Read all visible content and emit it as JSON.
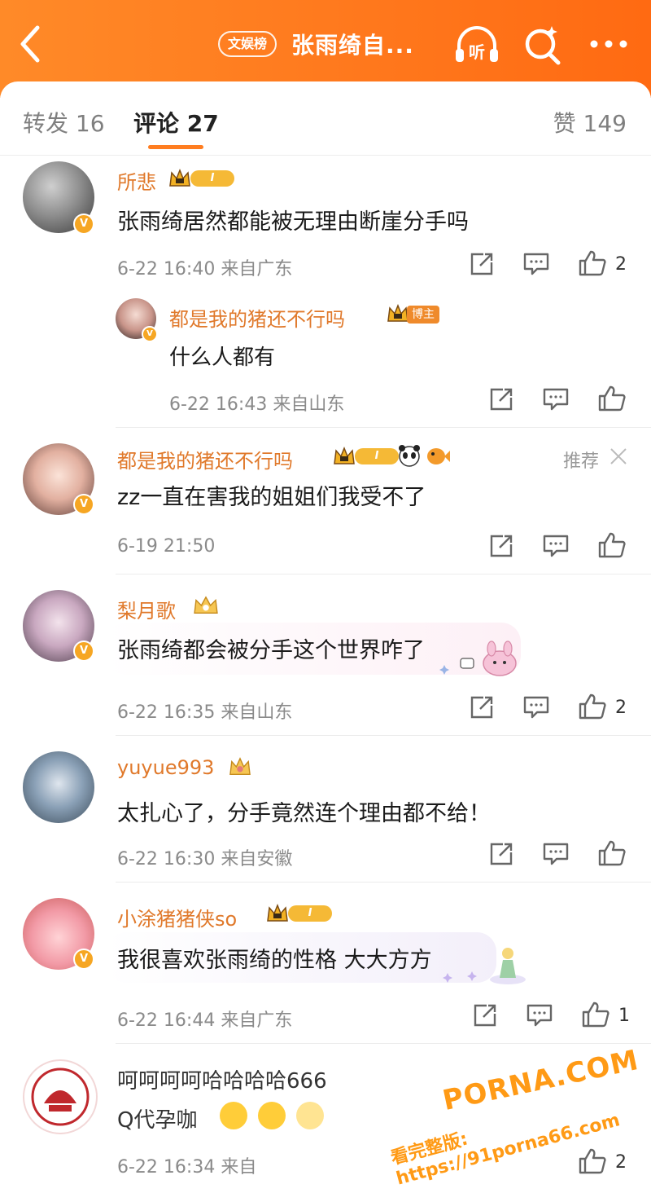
{
  "header": {
    "back_icon": "chevron-left-icon",
    "tag": "文娱榜",
    "title": "张雨绮自...",
    "listen_label": "听",
    "search_icon": "search-sparkle-icon",
    "more_icon": "more-dots-icon"
  },
  "tabs": {
    "repost": "转发 16",
    "comment": "评论 27",
    "like": "赞 149"
  },
  "comments": [
    {
      "username": "所悲",
      "level": "I",
      "text": "张雨绮居然都能被无理由断崖分手吗",
      "meta": "6-22 16:40 来自广东",
      "likes": "2",
      "reply": {
        "username": "都是我的猪还不行吗",
        "role_badge": "博主",
        "text": "什么人都有",
        "meta": "6-22 16:43 来自山东"
      }
    },
    {
      "username": "都是我的猪还不行吗",
      "level": "I",
      "recommend": "推荐",
      "text": "zz一直在害我的姐姐们我受不了",
      "meta": "6-19 21:50"
    },
    {
      "username": "梨月歌",
      "text": "张雨绮都会被分手这个世界咋了",
      "meta": "6-22 16:35 来自山东",
      "likes": "2"
    },
    {
      "username": "yuyue993",
      "text": "太扎心了，分手竟然连个理由都不给！",
      "meta": "6-22 16:30 来自安徽"
    },
    {
      "username": "小涂猪猪侠so",
      "level": "I",
      "text": "我很喜欢张雨绮的性格 大大方方",
      "meta": "6-22 16:44 来自广东",
      "likes": "1"
    },
    {
      "text": "呵呵呵呵哈哈哈哈666",
      "text2": "Q代孕咖",
      "meta": "6-22 16:34 来自",
      "likes": "2"
    }
  ],
  "watermark": {
    "line1": "PORNA.COM",
    "line2": "看完整版: https://91porna66.com"
  },
  "colors": {
    "header_orange": "#ff7a1e",
    "username_orange": "#e0792b",
    "tab_underline": "#ff7d20",
    "verified_badge": "#f6a623"
  }
}
